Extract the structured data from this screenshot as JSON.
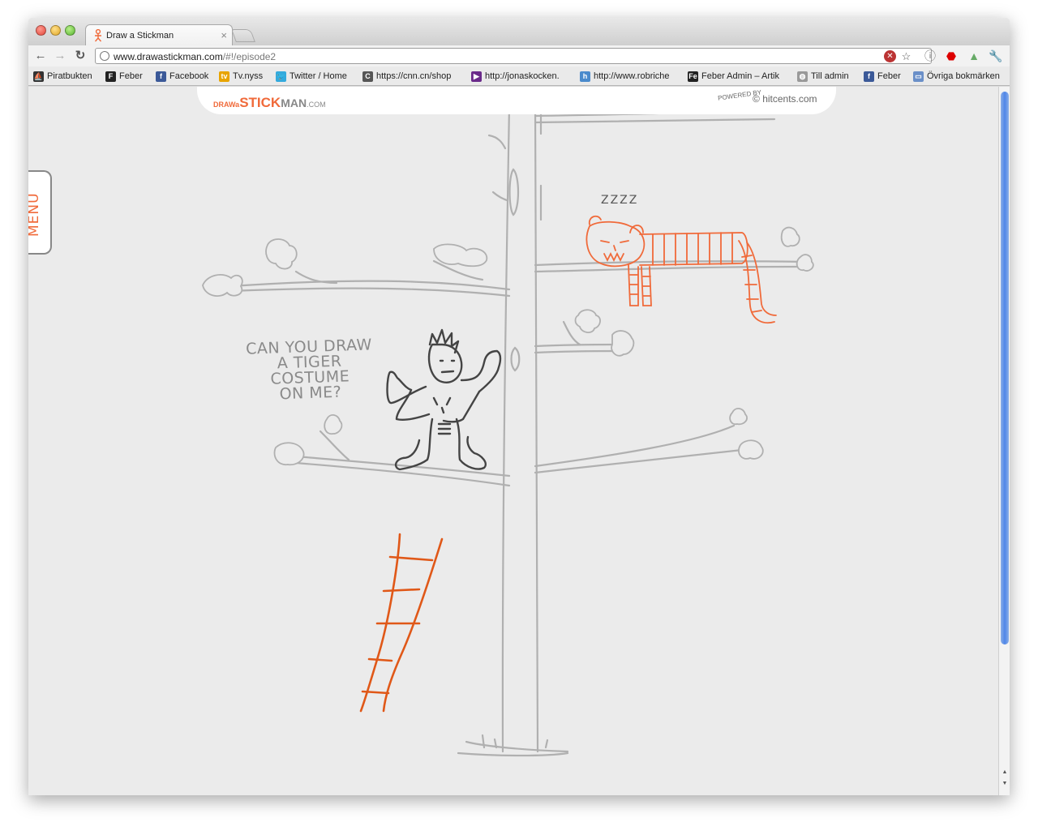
{
  "browser": {
    "tab_title": "Draw a Stickman",
    "tab_close": "×",
    "url_domain": "www.drawastickman.com",
    "url_path": "/#!/episode2",
    "nav": {
      "back": "←",
      "forward": "→",
      "reload": "↻"
    }
  },
  "bookmarks": [
    {
      "label": "Piratbukten",
      "icon": "pirate-ship-icon",
      "color": "#333333"
    },
    {
      "label": "Feber",
      "icon": "feber-f-icon",
      "color": "#222222"
    },
    {
      "label": "Facebook",
      "icon": "facebook-icon",
      "color": "#3b5998"
    },
    {
      "label": "Tv.nyss",
      "icon": "tv-icon",
      "color": "#e8a400"
    },
    {
      "label": "Twitter / Home",
      "icon": "twitter-bird-icon",
      "color": "#33aadd"
    },
    {
      "label": "https://cnn.cn/shop",
      "icon": "cnn-icon",
      "color": "#555555"
    },
    {
      "label": "http://jonaskocken.",
      "icon": "play-icon",
      "color": "#6a2a8a"
    },
    {
      "label": "http://www.robriche",
      "icon": "h-icon",
      "color": "#4a8acc"
    },
    {
      "label": "Feber Admin – Artik",
      "icon": "fe-icon",
      "color": "#222222"
    },
    {
      "label": "Till admin",
      "icon": "globe-icon",
      "color": "#999999"
    },
    {
      "label": "Feber",
      "icon": "facebook-icon",
      "color": "#3b5998"
    },
    {
      "label": "Övriga bokmärken",
      "icon": "folder-icon",
      "color": "#6a8fc8"
    }
  ],
  "page": {
    "menu_label": "MENU",
    "logo": {
      "draw": "DRAW",
      "a": "a",
      "stick": "STICK",
      "man": "MAN",
      "com": ".COM"
    },
    "powered_by": "POWERED BY",
    "hitcents": "hitcents.com",
    "speech_lines": [
      "CAN YOU DRAW",
      "A TIGER COSTUME",
      "ON ME?"
    ],
    "zzz": "ZZZZ"
  },
  "colors": {
    "accent_orange": "#f06a3a",
    "ladder": "#e05818",
    "pencil": "#b0b0b0",
    "stickman": "#444444"
  }
}
